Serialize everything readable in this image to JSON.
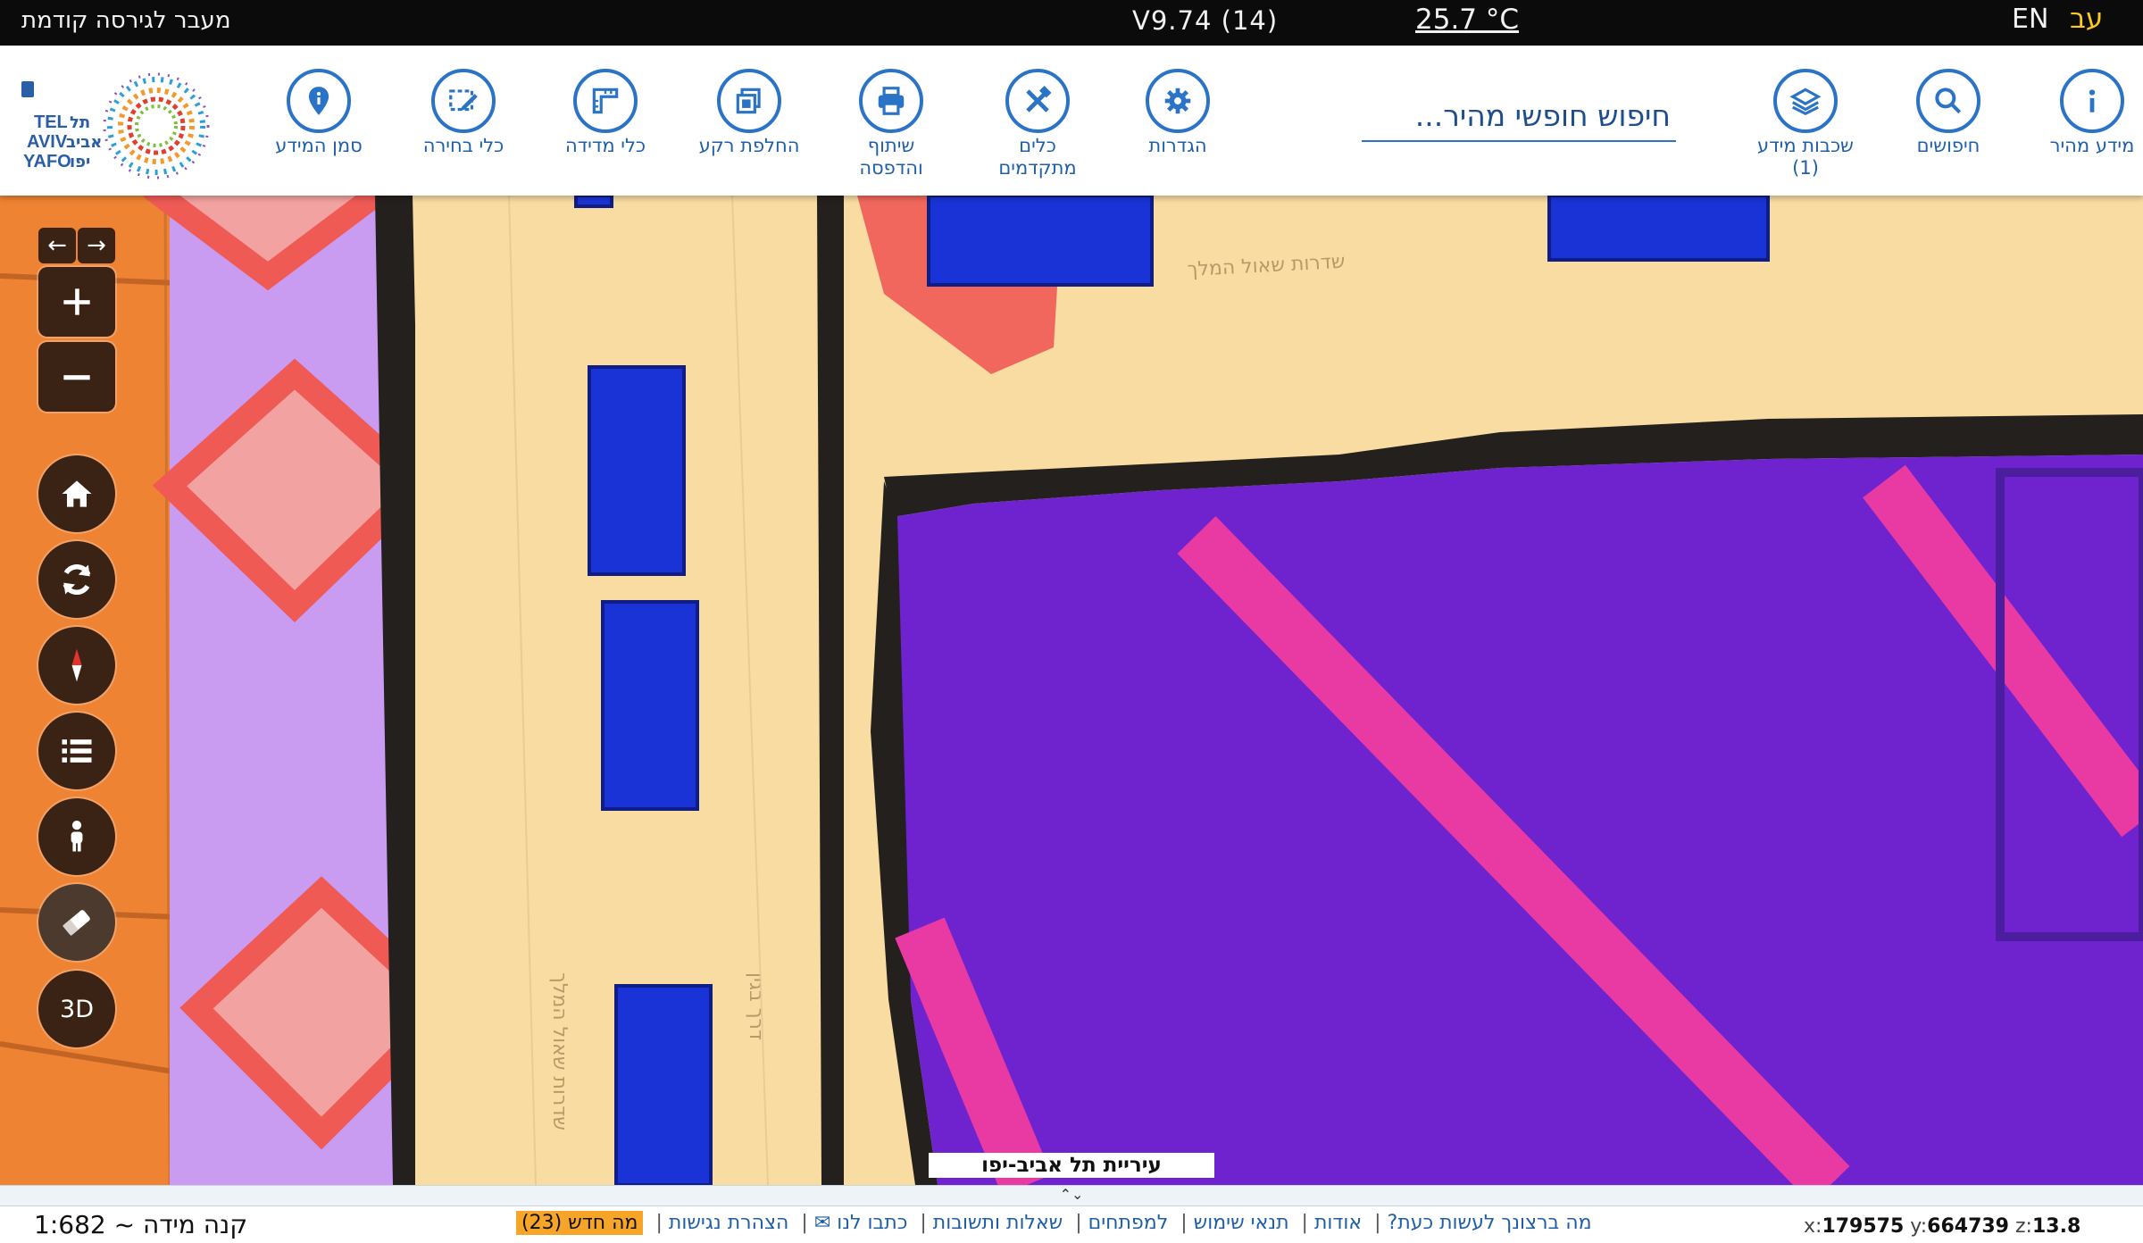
{
  "topbar": {
    "prev_version": "מעבר לגירסה קודמת",
    "version": "V9.74 (14)",
    "temperature": "25.7 °C",
    "lang_en": "EN",
    "lang_he": "עב"
  },
  "toolbar": {
    "tools": [
      {
        "label": "מידע מהיר",
        "icon": "info-icon"
      },
      {
        "label": "חיפושים",
        "icon": "search-icon"
      },
      {
        "label": "שכבות מידע (1)",
        "icon": "layers-icon"
      },
      {
        "label": "הגדרות",
        "icon": "gear-icon"
      },
      {
        "label": "כלים מתקדמים",
        "icon": "tools-icon"
      },
      {
        "label": "שיתוף והדפסה",
        "icon": "printer-icon"
      },
      {
        "label": "החלפת רקע",
        "icon": "basemap-icon"
      },
      {
        "label": "כלי מדידה",
        "icon": "ruler-icon"
      },
      {
        "label": "כלי בחירה",
        "icon": "selection-icon"
      },
      {
        "label": "סמן המידע",
        "icon": "map-pin-icon"
      }
    ],
    "search_placeholder": "חיפוש חופשי מהיר...",
    "logo_text": "תל אביב יפו TEL AVIV YAFO"
  },
  "map": {
    "street_labels": [
      "שדרות שאול המלך",
      "שדרות שאול המלך",
      "דרך בגין"
    ],
    "copyright": "עיריית תל אביב-יפו",
    "controls": [
      "back-arrow-icon",
      "forward-arrow-icon",
      "zoom-in-icon",
      "zoom-out-icon",
      "home-icon",
      "refresh-icon",
      "compass-icon",
      "legend-list-icon",
      "street-view-person-icon",
      "eraser-icon",
      "3d-button"
    ],
    "three_d_label": "3D",
    "colors": {
      "road_orange": "#ee8333",
      "lavender": "#c99cf2",
      "coral": "#ef5a55",
      "sand": "#f8dca1",
      "dark_outline": "#24201e",
      "purple": "#6e23cf",
      "magenta": "#e83aa2",
      "blue_block": "#1a33d6"
    }
  },
  "bottombar": {
    "handle": "⌃⌄",
    "scale": "קנה מידה ~ 1:682",
    "links": [
      "מה ברצונך לעשות כעת?",
      "אודות",
      "תנאי שימוש",
      "למפתחים",
      "שאלות ותשובות",
      "כתבו לנו ✉",
      "הצהרת נגישות"
    ],
    "news": "מה חדש (23)",
    "coords": {
      "x_label": "x:",
      "x": "179575",
      "y_label": "y:",
      "y": "664739",
      "z_label": "z:",
      "z": "13.8"
    }
  }
}
